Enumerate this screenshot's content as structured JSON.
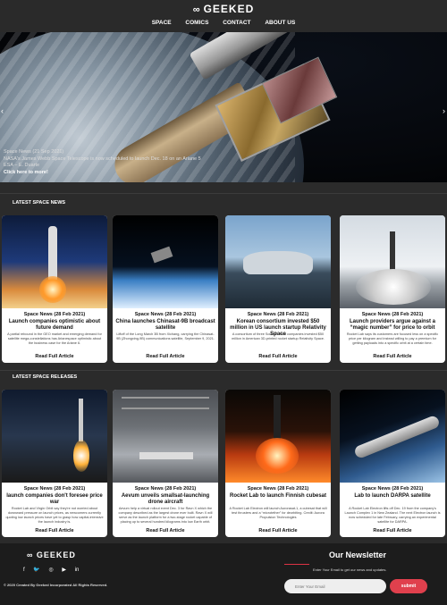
{
  "header": {
    "logo_text": "GEEKED",
    "nav": [
      "SPACE",
      "COMICS",
      "CONTACT",
      "ABOUT US"
    ]
  },
  "hero": {
    "caption_line1": "Space News (21 Sep 2021)",
    "caption_line2": "NASA's James Webb Space Telescope is now scheduled to launch Dec. 18 on an Ariane 5",
    "caption_line3": "ESA – E. Duarte",
    "more_label": "Click here to more!"
  },
  "latest_news": {
    "label": "LATEST SPACE NEWS",
    "cards": [
      {
        "date": "Space News (28 Feb 2021)",
        "title": "Launch companies optimistic about future demand",
        "desc": "A partial rebound in the GEO market and emerging demand for satellite mega-constellations has Arianespace optimistic about the business case for the Ariane 6.",
        "read": "Read Full Article"
      },
      {
        "date": "Space News (28 Feb 2021)",
        "title": "China launches Chinasat-9B broadcast satellite",
        "desc": "Liftoff of the Long March 3B from Xichang, carrying the Chinasat-9B (Zhongxing-9B) communications satellite, September 9, 2021.",
        "read": "Read Full Article"
      },
      {
        "date": "Space News (28 Feb 2021)",
        "title": "Korean consortium invested $50 million in US launch startup Relativity Space",
        "desc": "A consortium of three South Korean companies invested $50 million in American 3D-printed rocket startup Relativity Space.",
        "read": "Read Full Article"
      },
      {
        "date": "Space News (28 Feb 2021)",
        "title": "Launch providers argue against a “magic number” for price to orbit",
        "desc": "Rocket Lab says its customers are focused less on a specific price per kilogram and instead willing to pay a premium for getting payloads into a specific orbit at a certain time.",
        "read": "Read Full Article"
      }
    ]
  },
  "latest_releases": {
    "label": "LATEST SPACE RELEASES",
    "cards": [
      {
        "date": "Space News (28 Feb 2021)",
        "title": "launch companies don't foresee price war",
        "desc": "Rocket Lab and Virgin Orbit say they're not worried about downward pressure on launch prices, as newcomers currently quoting low launch prices have yet to grasp how capital-intensive the launch industry is.",
        "read": "Read Full Article"
      },
      {
        "date": "Space News (28 Feb 2021)",
        "title": "Aevum unveils smallsat-launching drone aircraft",
        "desc": "Aevum help a virtual rollout event Dec. 3 for Ravn X which the company described as the largest drone ever built. Ravn X will serve as the launch platform for a two-stage rocket capable of placing up to several hundred kilograms into low Earth orbit.",
        "read": "Read Full Article"
      },
      {
        "date": "Space News (28 Feb 2021)",
        "title": "Rocket Lab to launch Finnish cubesat",
        "desc": "A Rocket Lab Electron will launch Aurorasat-1, a cubesat that will test thrusters and a “microtether” for deorbiting. Credit: Aurora Propulsion Technologies",
        "read": "Read Full Article"
      },
      {
        "date": "Space News (28 Feb 2021)",
        "title": "Lab to launch DARPA satellite",
        "desc": "A Rocket Lab Electron lifts off Dec. 19 from the company's Launch Complex 1 in New Zealand. The next Electron launch is now scheduled for late February, carrying an experimental satellite for DARPA.",
        "read": "Read Full Article"
      }
    ]
  },
  "footer": {
    "logo_text": "GEEKED",
    "copyright": "© 2020 Created By Geeked Incorporated All Rights Reserved.",
    "newsletter_title": "Our Newsletter",
    "newsletter_sub": "Enter Your Email to get our news and updates.",
    "email_placeholder": "Enter Your Email",
    "submit_label": "submit",
    "social_icons": [
      "facebook-icon",
      "twitter-icon",
      "instagram-icon",
      "youtube-icon",
      "linkedin-icon"
    ]
  },
  "colors": {
    "accent": "#e0404d",
    "background": "#2b2b2b",
    "footer": "#1c1c1c"
  }
}
